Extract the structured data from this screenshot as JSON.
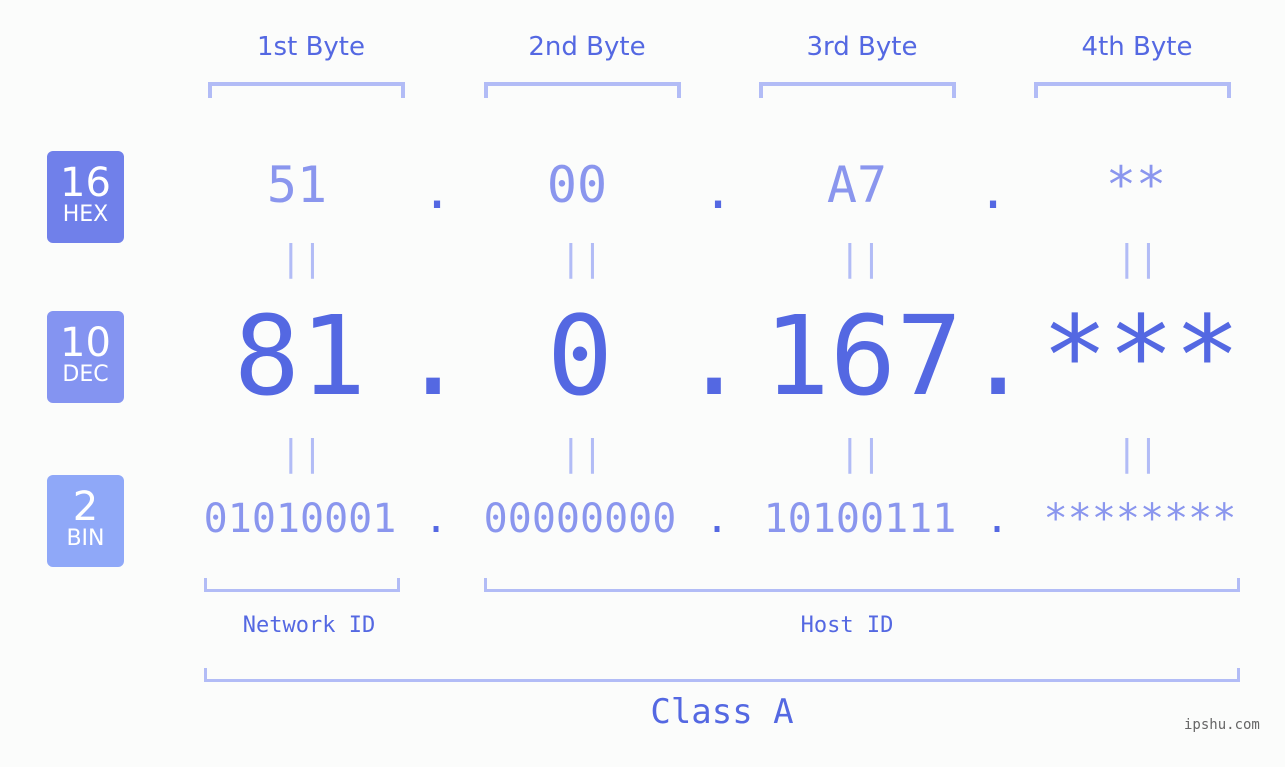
{
  "colors": {
    "hex_badge": "#7080ea",
    "dec_badge": "#8494f1",
    "bin_badge": "#8fa8f8",
    "accent": "#5468e2",
    "light": "#8a96ee",
    "bracket": "#b2bcf6"
  },
  "badges": [
    {
      "num": "16",
      "label": "HEX"
    },
    {
      "num": "10",
      "label": "DEC"
    },
    {
      "num": "2",
      "label": "BIN"
    }
  ],
  "headers": [
    "1st Byte",
    "2nd Byte",
    "3rd Byte",
    "4th Byte"
  ],
  "hex": [
    "51",
    "00",
    "A7",
    "**"
  ],
  "dec": [
    "81",
    "0",
    "167",
    "***"
  ],
  "bin": [
    "01010001",
    "00000000",
    "10100111",
    "********"
  ],
  "separator": ".",
  "equals": "||",
  "labels": {
    "network": "Network ID",
    "host": "Host ID",
    "class": "Class A"
  },
  "watermark": "ipshu.com"
}
